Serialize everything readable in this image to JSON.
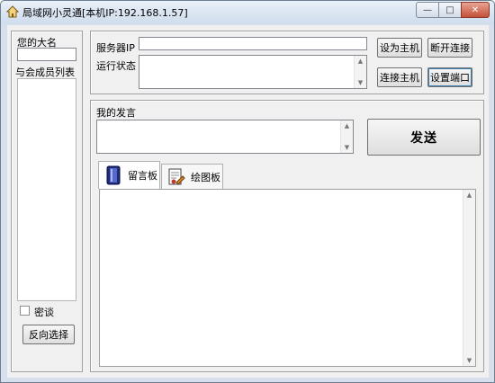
{
  "window": {
    "title": "局域网小灵通[本机IP:192.168.1.57]"
  },
  "left_panel": {
    "name_label": "您的大名",
    "name_value": "",
    "members_label": "与会成员列表",
    "members": [],
    "private_chat_label": "密谈",
    "private_chat_checked": false,
    "invert_selection_label": "反向选择"
  },
  "server": {
    "ip_label": "服务器IP",
    "ip_value": "",
    "status_label": "运行状态",
    "status_value": "",
    "set_host_label": "设为主机",
    "disconnect_label": "断开连接",
    "connect_host_label": "连接主机",
    "set_port_label": "设置端口"
  },
  "chat": {
    "my_message_label": "我的发言",
    "message_value": "",
    "send_label": "发送"
  },
  "tabs": [
    {
      "label": "留言板",
      "icon": "message-board-icon",
      "active": true
    },
    {
      "label": "绘图板",
      "icon": "drawing-board-icon",
      "active": false
    }
  ]
}
